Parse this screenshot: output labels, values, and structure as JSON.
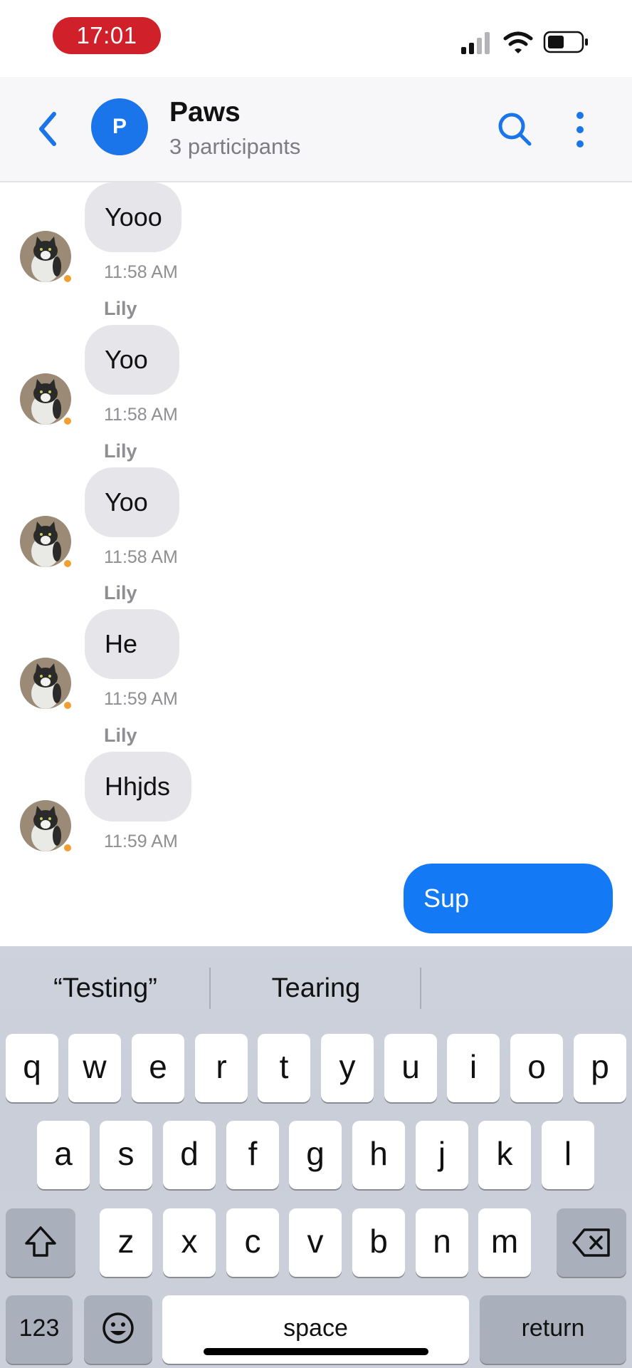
{
  "status_bar": {
    "time": "17:01"
  },
  "header": {
    "avatar_letter": "P",
    "title": "Paws",
    "subtitle": "3 participants"
  },
  "messages": {
    "sender_name": "Lily",
    "incoming": [
      {
        "text": "Yooo",
        "time": "11:58 AM"
      },
      {
        "text": "Yoo",
        "time": "11:58 AM"
      },
      {
        "text": "Yoo",
        "time": "11:58 AM"
      },
      {
        "text": "He",
        "time": "11:59 AM"
      },
      {
        "text": "Hhjds",
        "time": "11:59 AM"
      }
    ],
    "outgoing": [
      {
        "text": "Sup"
      }
    ]
  },
  "keyboard": {
    "suggestions": [
      "“Testing”",
      "Tearing",
      ""
    ],
    "row1": [
      "q",
      "w",
      "e",
      "r",
      "t",
      "y",
      "u",
      "i",
      "o",
      "p"
    ],
    "row2": [
      "a",
      "s",
      "d",
      "f",
      "g",
      "h",
      "j",
      "k",
      "l"
    ],
    "row3": [
      "z",
      "x",
      "c",
      "v",
      "b",
      "n",
      "m"
    ],
    "numbers_label": "123",
    "space_label": "space",
    "return_label": "return"
  },
  "colors": {
    "accent": "#1a74ea",
    "outgoing_bubble": "#1479f4",
    "incoming_bubble": "#e5e5ea",
    "time_pill": "#d0202a",
    "online_dot": "#f0a030"
  }
}
